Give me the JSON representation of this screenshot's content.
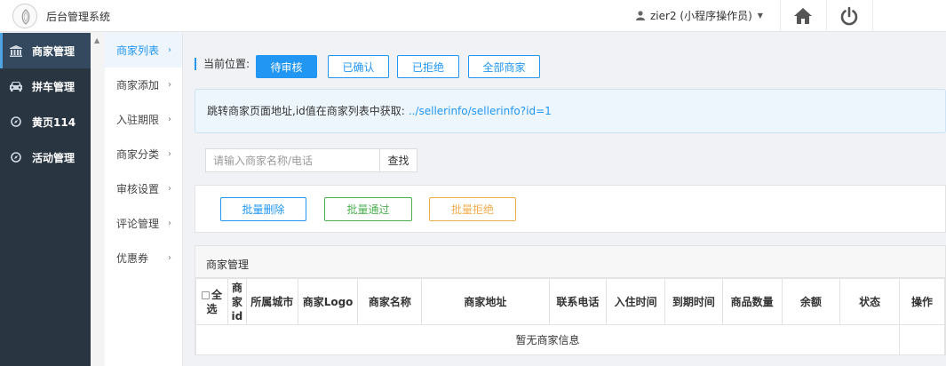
{
  "header": {
    "app_title": "后台管理系统",
    "user_label": "zier2 (小程序操作员)",
    "icons": [
      "logo-icon",
      "user-icon",
      "home-icon",
      "power-icon"
    ]
  },
  "sidebar": {
    "items": [
      {
        "label": "商家管理",
        "icon": "bank-icon",
        "active": true
      },
      {
        "label": "拼车管理",
        "icon": "car-icon",
        "active": false
      },
      {
        "label": "黄页114",
        "icon": "compass-icon",
        "active": false
      },
      {
        "label": "活动管理",
        "icon": "compass-icon",
        "active": false
      }
    ]
  },
  "submenu": {
    "items": [
      {
        "label": "商家列表",
        "active": true
      },
      {
        "label": "商家添加",
        "active": false
      },
      {
        "label": "入驻期限",
        "active": false
      },
      {
        "label": "商家分类",
        "active": false
      },
      {
        "label": "审核设置",
        "active": false
      },
      {
        "label": "评论管理",
        "active": false
      },
      {
        "label": "优惠券",
        "active": false
      }
    ],
    "chevron": "›"
  },
  "breadcrumb": {
    "label": "当前位置:"
  },
  "filters": [
    {
      "label": "待审核",
      "active": true
    },
    {
      "label": "已确认",
      "active": false
    },
    {
      "label": "已拒绝",
      "active": false
    },
    {
      "label": "全部商家",
      "active": false
    }
  ],
  "notice": {
    "text": "跳转商家页面地址,id值在商家列表中获取:",
    "link": "../sellerinfo/sellerinfo?id=1"
  },
  "search": {
    "placeholder": "请输入商家名称/电话",
    "button": "查找"
  },
  "batch": {
    "delete": "批量删除",
    "pass": "批量通过",
    "reject": "批量拒绝"
  },
  "colors": {
    "primary": "#2196f3",
    "success": "#4caf50",
    "warning": "#f0ad4e",
    "sidebar_bg": "#2a3542"
  },
  "table": {
    "title": "商家管理",
    "columns": [
      "全选",
      "商家id",
      "所属城市",
      "商家Logo",
      "商家名称",
      "商家地址",
      "联系电话",
      "入住时间",
      "到期时间",
      "商品数量",
      "余额",
      "状态",
      "操作"
    ],
    "empty_text": "暂无商家信息"
  }
}
